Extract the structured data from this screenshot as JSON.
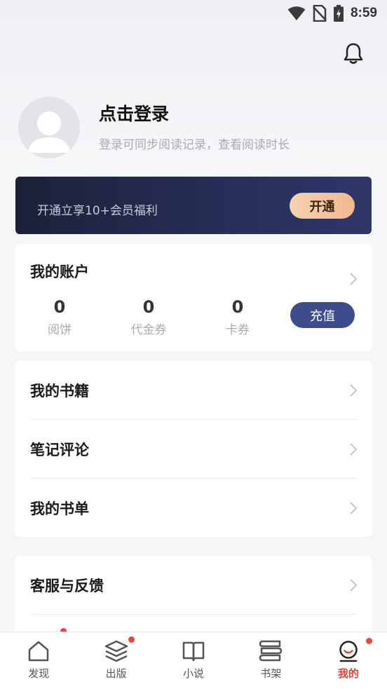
{
  "status_bar": {
    "time": "8:59"
  },
  "profile": {
    "login_title": "点击登录",
    "login_subtitle": "登录可同步阅读记录，查看阅读时长"
  },
  "vip": {
    "text": "开通立享10+会员福利",
    "button": "开通"
  },
  "account": {
    "title": "我的账户",
    "stats": [
      {
        "value": "0",
        "label": "阅饼"
      },
      {
        "value": "0",
        "label": "代金券"
      },
      {
        "value": "0",
        "label": "卡券"
      }
    ],
    "recharge_button": "充值"
  },
  "menu": {
    "my_books": "我的书籍",
    "notes_comments": "笔记评论",
    "my_booklist": "我的书单",
    "service_feedback": "客服与反馈"
  },
  "bottom_nav": [
    {
      "label": "发现",
      "icon": "house-icon"
    },
    {
      "label": "出版",
      "icon": "layers-icon"
    },
    {
      "label": "小说",
      "icon": "book-open-icon"
    },
    {
      "label": "书架",
      "icon": "bookshelf-icon"
    },
    {
      "label": "我的",
      "icon": "profile-face-icon"
    }
  ],
  "colors": {
    "accent": "#e0423a",
    "vip_button": "#f2b891",
    "recharge_button": "#3f4c8c",
    "banner": "#262d55"
  }
}
